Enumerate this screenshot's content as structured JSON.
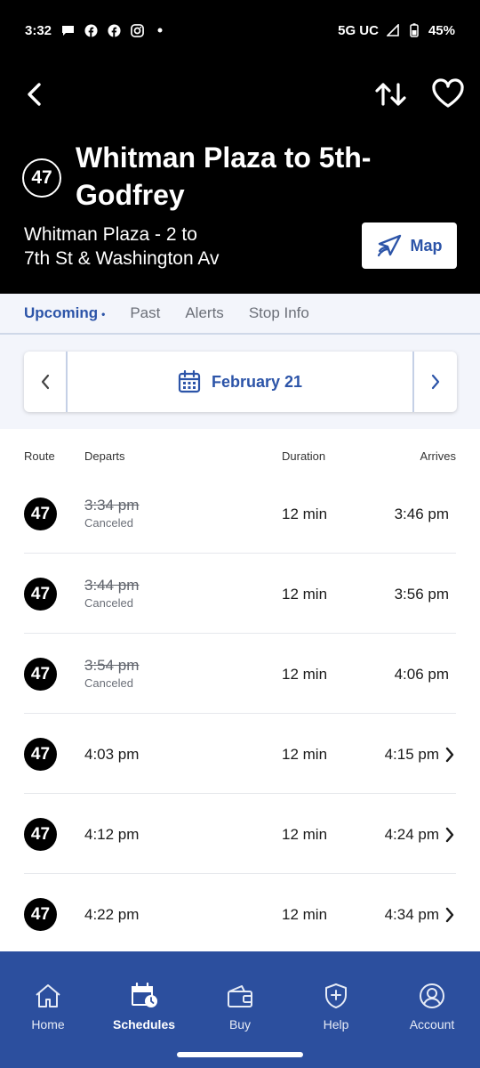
{
  "status_bar": {
    "time": "3:32",
    "network": "5G UC",
    "battery": "45%",
    "notification_icons": [
      "chat-bubble-icon",
      "facebook-icon",
      "facebook-icon",
      "instagram-icon",
      "dot-icon"
    ]
  },
  "header": {
    "route_number": "47",
    "title": "Whitman Plaza to 5th-Godfrey",
    "subtitle_line1": "Whitman Plaza - 2 to",
    "subtitle_line2": "7th St & Washington Av",
    "map_label": "Map"
  },
  "tabs": [
    {
      "label": "Upcoming",
      "dot": "•",
      "active": true
    },
    {
      "label": "Past",
      "active": false
    },
    {
      "label": "Alerts",
      "active": false
    },
    {
      "label": "Stop Info",
      "active": false
    }
  ],
  "date_selector": {
    "date": "February 21"
  },
  "table": {
    "headers": {
      "route": "Route",
      "departs": "Departs",
      "duration": "Duration",
      "arrives": "Arrives"
    },
    "rows": [
      {
        "route": "47",
        "departs": "3:34 pm",
        "status": "Canceled",
        "duration": "12 min",
        "arrives": "3:46 pm"
      },
      {
        "route": "47",
        "departs": "3:44 pm",
        "status": "Canceled",
        "duration": "12 min",
        "arrives": "3:56 pm"
      },
      {
        "route": "47",
        "departs": "3:54 pm",
        "status": "Canceled",
        "duration": "12 min",
        "arrives": "4:06 pm"
      },
      {
        "route": "47",
        "departs": "4:03 pm",
        "status": "",
        "duration": "12 min",
        "arrives": "4:15 pm"
      },
      {
        "route": "47",
        "departs": "4:12 pm",
        "status": "",
        "duration": "12 min",
        "arrives": "4:24 pm"
      },
      {
        "route": "47",
        "departs": "4:22 pm",
        "status": "",
        "duration": "12 min",
        "arrives": "4:34 pm"
      }
    ]
  },
  "bottom_nav": {
    "items": [
      {
        "label": "Home",
        "icon": "home-icon",
        "active": false
      },
      {
        "label": "Schedules",
        "icon": "calendar-clock-icon",
        "active": true
      },
      {
        "label": "Buy",
        "icon": "wallet-icon",
        "active": false
      },
      {
        "label": "Help",
        "icon": "shield-plus-icon",
        "active": false
      },
      {
        "label": "Account",
        "icon": "user-circle-icon",
        "active": false
      }
    ]
  },
  "colors": {
    "brand_blue": "#2c54a8",
    "nav_blue": "#2c4f9e",
    "header_bg": "#000000",
    "tab_bg": "#f3f5fb"
  }
}
